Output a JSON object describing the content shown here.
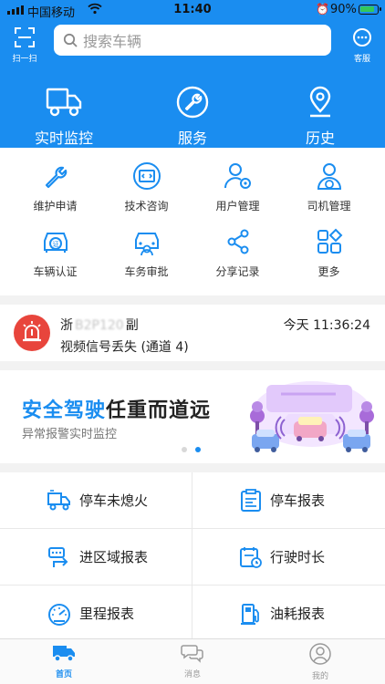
{
  "status_bar": {
    "carrier": "中国移动",
    "time": "11:40",
    "battery": "90%"
  },
  "header": {
    "scan_label": "扫一扫",
    "search_placeholder": "搜索车辆",
    "service_label": "客服",
    "nav": [
      {
        "label": "实时监控",
        "icon": "truck-icon"
      },
      {
        "label": "服务",
        "icon": "wrench-icon"
      },
      {
        "label": "历史",
        "icon": "location-pin-icon"
      }
    ]
  },
  "grid": [
    {
      "label": "维护申请",
      "icon": "wrench-icon"
    },
    {
      "label": "技术咨询",
      "icon": "code-window-icon"
    },
    {
      "label": "用户管理",
      "icon": "user-gear-icon"
    },
    {
      "label": "司机管理",
      "icon": "driver-icon"
    },
    {
      "label": "车辆认证",
      "icon": "car-certified-icon"
    },
    {
      "label": "车务审批",
      "icon": "car-approve-icon"
    },
    {
      "label": "分享记录",
      "icon": "share-icon"
    },
    {
      "label": "更多",
      "icon": "more-apps-icon"
    }
  ],
  "alert": {
    "plate_prefix": "浙",
    "plate_blurred": "B2P120",
    "plate_suffix": "副",
    "time": "今天 11:36:24",
    "message": "视频信号丢失 (通道 4)"
  },
  "banner": {
    "title_highlight": "安全驾驶",
    "title_rest": "任重而道远",
    "subtitle": "异常报警实时监控"
  },
  "reports": [
    {
      "label": "停车未熄火",
      "icon": "truck-idle-icon"
    },
    {
      "label": "停车报表",
      "icon": "parking-report-icon"
    },
    {
      "label": "进区域报表",
      "icon": "area-entry-icon"
    },
    {
      "label": "行驶时长",
      "icon": "driving-time-icon"
    },
    {
      "label": "里程报表",
      "icon": "speedometer-icon"
    },
    {
      "label": "油耗报表",
      "icon": "fuel-pump-icon"
    }
  ],
  "tabbar": [
    {
      "label": "首页",
      "icon": "home-truck-icon"
    },
    {
      "label": "消息",
      "icon": "message-bubbles-icon"
    },
    {
      "label": "我的",
      "icon": "profile-icon"
    }
  ],
  "colors": {
    "primary": "#1a8df0",
    "alert": "#e8453c"
  }
}
